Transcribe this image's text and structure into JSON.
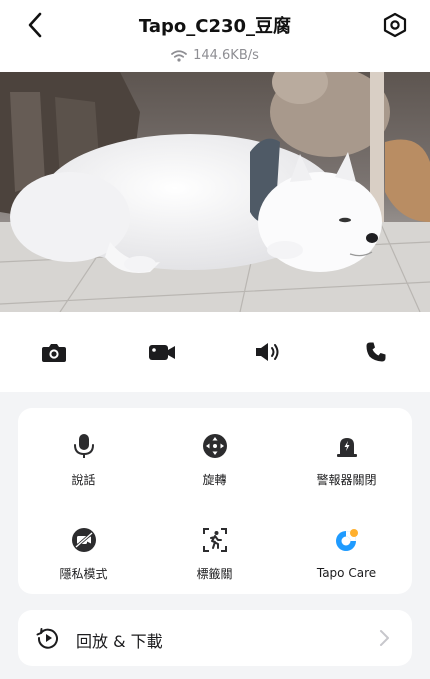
{
  "header": {
    "title": "Tapo_C230_豆腐",
    "speed": "144.6KB/s",
    "back_icon": "chevron-left-icon",
    "settings_icon": "hexagon-settings-icon"
  },
  "controls": [
    {
      "name": "snapshot",
      "icon": "camera-icon"
    },
    {
      "name": "record",
      "icon": "video-camera-icon"
    },
    {
      "name": "audio",
      "icon": "speaker-icon"
    },
    {
      "name": "call",
      "icon": "phone-icon"
    }
  ],
  "features": [
    {
      "label": "說話",
      "icon": "microphone-icon"
    },
    {
      "label": "旋轉",
      "icon": "pan-tilt-icon"
    },
    {
      "label": "警報器關閉",
      "icon": "siren-icon"
    },
    {
      "label": "隱私模式",
      "icon": "privacy-icon"
    },
    {
      "label": "標籤關",
      "icon": "motion-tag-icon"
    },
    {
      "label": "Tapo Care",
      "icon": "tapo-care-icon"
    }
  ],
  "playback": {
    "label": "回放 & 下載",
    "icon": "playback-icon"
  },
  "colors": {
    "accent": "#1f9bff",
    "brand_orange": "#ffb02e",
    "text": "#1c1c1e",
    "muted": "#8e8e93"
  }
}
